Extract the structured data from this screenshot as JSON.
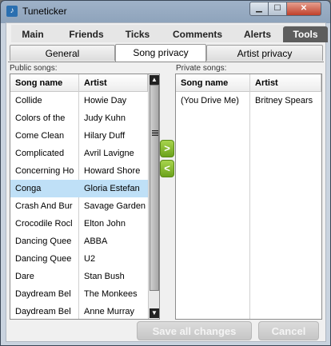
{
  "window": {
    "title": "Tuneticker"
  },
  "main_tabs": [
    "Main",
    "Friends",
    "Ticks",
    "Comments",
    "Alerts",
    "Tools"
  ],
  "active_main_tab": "Tools",
  "sub_tabs": [
    "General",
    "Song privacy",
    "Artist privacy"
  ],
  "active_sub_tab": "Song privacy",
  "public": {
    "label": "Public songs:",
    "col_song": "Song name",
    "col_artist": "Artist",
    "rows": [
      [
        "Collide",
        "Howie Day"
      ],
      [
        "Colors of the",
        "Judy Kuhn"
      ],
      [
        "Come Clean",
        "Hilary Duff"
      ],
      [
        "Complicated",
        "Avril Lavigne"
      ],
      [
        "Concerning Ho",
        "Howard Shore"
      ],
      [
        "Conga",
        "Gloria Estefan"
      ],
      [
        "Crash And Bur",
        "Savage Garden"
      ],
      [
        "Crocodile Rocl",
        "Elton John"
      ],
      [
        "Dancing Quee",
        "ABBA"
      ],
      [
        "Dancing Quee",
        "U2"
      ],
      [
        "Dare",
        "Stan Bush"
      ],
      [
        "Daydream Bel",
        "The Monkees"
      ],
      [
        "Daydream Bel",
        "Anne Murray"
      ]
    ],
    "selected_row": 5
  },
  "private": {
    "label": "Private songs:",
    "col_song": "Song name",
    "col_artist": "Artist",
    "rows": [
      [
        "(You Drive Me)",
        "Britney Spears"
      ]
    ]
  },
  "move_right_label": ">",
  "move_left_label": "<",
  "save_label": "Save all changes",
  "cancel_label": "Cancel",
  "colors": {
    "selected_row": "#bfe0f7",
    "active_tab": "#5d5d5d",
    "move_button": "#7ab52a"
  }
}
